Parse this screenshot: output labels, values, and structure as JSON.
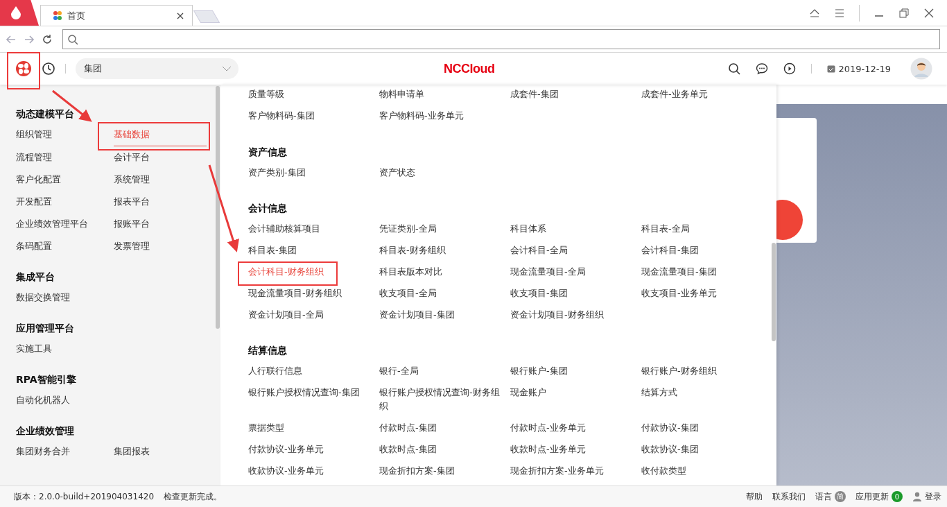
{
  "browser": {
    "tab_title": "首页"
  },
  "header": {
    "org_select": "集团",
    "brand": "NCCloud",
    "date": "2019-12-19"
  },
  "sidebar": {
    "sections": [
      {
        "title": "动态建模平台",
        "items": [
          {
            "label": "组织管理",
            "selected": false
          },
          {
            "label": "基础数据",
            "selected": true
          },
          {
            "label": "流程管理",
            "selected": false
          },
          {
            "label": "会计平台",
            "selected": false
          },
          {
            "label": "客户化配置",
            "selected": false
          },
          {
            "label": "系统管理",
            "selected": false
          },
          {
            "label": "开发配置",
            "selected": false
          },
          {
            "label": "报表平台",
            "selected": false
          },
          {
            "label": "企业绩效管理平台",
            "selected": false
          },
          {
            "label": "报账平台",
            "selected": false
          },
          {
            "label": "条码配置",
            "selected": false
          },
          {
            "label": "发票管理",
            "selected": false
          }
        ]
      },
      {
        "title": "集成平台",
        "items": [
          {
            "label": "数据交换管理",
            "selected": false
          }
        ]
      },
      {
        "title": "应用管理平台",
        "items": [
          {
            "label": "实施工具",
            "selected": false
          }
        ]
      },
      {
        "title": "RPA智能引擎",
        "items": [
          {
            "label": "自动化机器人",
            "selected": false
          }
        ]
      },
      {
        "title": "企业绩效管理",
        "items": [
          {
            "label": "集团财务合并",
            "selected": false
          },
          {
            "label": "集团报表",
            "selected": false
          }
        ]
      }
    ]
  },
  "menu": {
    "sections": [
      {
        "items": [
          {
            "label": "质量等级",
            "selected": false
          },
          {
            "label": "物料申请单",
            "selected": false
          },
          {
            "label": "成套件-集团",
            "selected": false
          },
          {
            "label": "成套件-业务单元",
            "selected": false
          },
          {
            "label": "客户物料码-集团",
            "selected": false
          },
          {
            "label": "客户物料码-业务单元",
            "selected": false
          }
        ]
      },
      {
        "title": "资产信息",
        "items": [
          {
            "label": "资产类别-集团",
            "selected": false
          },
          {
            "label": "资产状态",
            "selected": false
          }
        ]
      },
      {
        "title": "会计信息",
        "items": [
          {
            "label": "会计辅助核算项目",
            "selected": false
          },
          {
            "label": "凭证类别-全局",
            "selected": false
          },
          {
            "label": "科目体系",
            "selected": false
          },
          {
            "label": "科目表-全局",
            "selected": false
          },
          {
            "label": "科目表-集团",
            "selected": false
          },
          {
            "label": "科目表-财务组织",
            "selected": false
          },
          {
            "label": "会计科目-全局",
            "selected": false
          },
          {
            "label": "会计科目-集团",
            "selected": false
          },
          {
            "label": "会计科目-财务组织",
            "selected": true
          },
          {
            "label": "科目表版本对比",
            "selected": false
          },
          {
            "label": "现金流量项目-全局",
            "selected": false
          },
          {
            "label": "现金流量项目-集团",
            "selected": false
          },
          {
            "label": "现金流量项目-财务组织",
            "selected": false
          },
          {
            "label": "收支项目-全局",
            "selected": false
          },
          {
            "label": "收支项目-集团",
            "selected": false
          },
          {
            "label": "收支项目-业务单元",
            "selected": false
          },
          {
            "label": "资金计划项目-全局",
            "selected": false
          },
          {
            "label": "资金计划项目-集团",
            "selected": false
          },
          {
            "label": "资金计划项目-财务组织",
            "selected": false
          }
        ]
      },
      {
        "title": "结算信息",
        "items": [
          {
            "label": "人行联行信息",
            "selected": false
          },
          {
            "label": "银行-全局",
            "selected": false
          },
          {
            "label": "银行账户-集团",
            "selected": false
          },
          {
            "label": "银行账户-财务组织",
            "selected": false
          },
          {
            "label": "银行账户授权情况查询-集团",
            "selected": false
          },
          {
            "label": "银行账户授权情况查询-财务组织",
            "selected": false
          },
          {
            "label": "现金账户",
            "selected": false
          },
          {
            "label": "结算方式",
            "selected": false
          },
          {
            "label": "票据类型",
            "selected": false
          },
          {
            "label": "付款时点-集团",
            "selected": false
          },
          {
            "label": "付款时点-业务单元",
            "selected": false
          },
          {
            "label": "付款协议-集团",
            "selected": false
          },
          {
            "label": "付款协议-业务单元",
            "selected": false
          },
          {
            "label": "收款时点-集团",
            "selected": false
          },
          {
            "label": "收款时点-业务单元",
            "selected": false
          },
          {
            "label": "收款协议-集团",
            "selected": false
          },
          {
            "label": "收款协议-业务单元",
            "selected": false
          },
          {
            "label": "现金折扣方案-集团",
            "selected": false
          },
          {
            "label": "现金折扣方案-业务单元",
            "selected": false
          },
          {
            "label": "收付款类型",
            "selected": false
          }
        ]
      }
    ]
  },
  "status_bar": {
    "version": "版本：2.0.0-build+201904031420",
    "message": "检查更新完成。",
    "help": "帮助",
    "contact": "联系我们",
    "language": "语言",
    "language_badge": "简",
    "updates": "应用更新",
    "updates_badge": "0",
    "login": "登录"
  }
}
